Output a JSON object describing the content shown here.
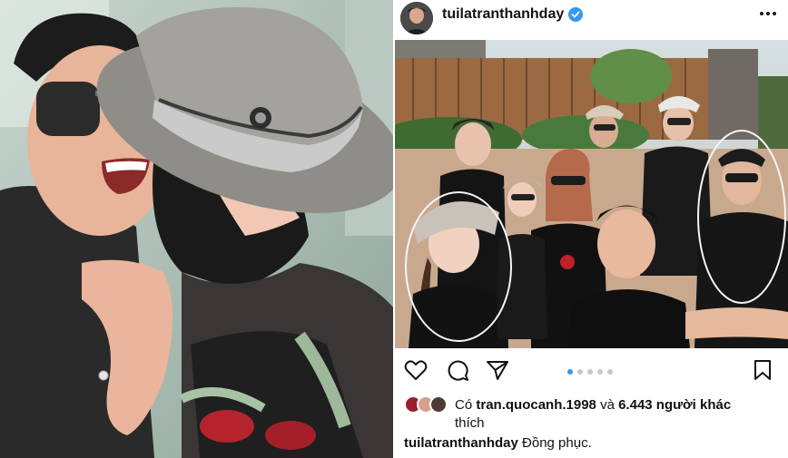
{
  "post": {
    "username": "tuilatranthanhday",
    "verified": true,
    "liked_by_prefix": "Có",
    "liked_by_user": "tran.quocanh.1998",
    "liked_by_joiner": "và",
    "liked_by_others": "6.443 người khác",
    "liked_by_suffix": "thích",
    "caption_user": "tuilatranthanhday",
    "caption_text": "Đồng phục.",
    "carousel": {
      "count": 5,
      "active": 1
    }
  },
  "colors": {
    "verified": "#3897f0",
    "dot_active": "#3897f0",
    "dot_inactive": "#c7c7c7",
    "text": "#111111"
  },
  "icons": [
    "heart-icon",
    "comment-icon",
    "share-icon",
    "bookmark-icon",
    "more-icon",
    "verified-icon"
  ]
}
